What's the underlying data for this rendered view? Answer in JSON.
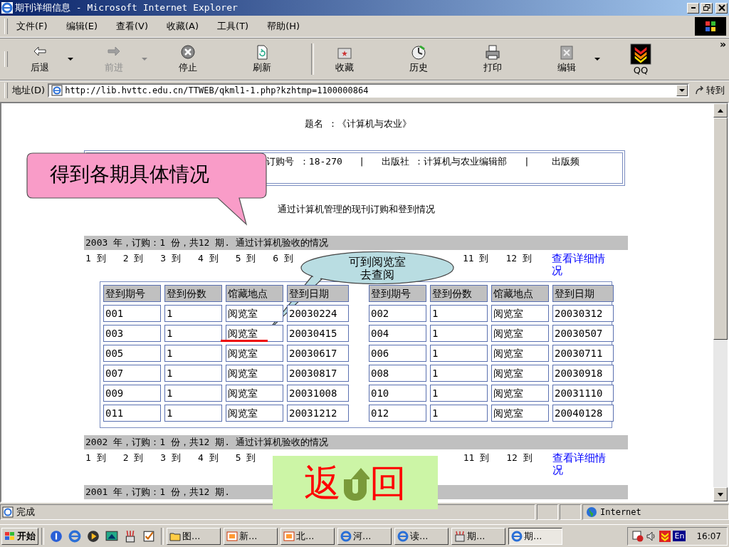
{
  "window": {
    "title": "期刊详细信息 - Microsoft Internet Explorer"
  },
  "menu": [
    "文件(F)",
    "编辑(E)",
    "查看(V)",
    "收藏(A)",
    "工具(T)",
    "帮助(H)"
  ],
  "toolbar": [
    {
      "label": "后退",
      "kind": "back",
      "disabled": false,
      "dropdown": true
    },
    {
      "label": "前进",
      "kind": "forward",
      "disabled": true,
      "dropdown": true
    },
    {
      "label": "停止",
      "kind": "stop",
      "disabled": false,
      "dropdown": false
    },
    {
      "label": "刷新",
      "kind": "refresh",
      "disabled": false,
      "dropdown": false
    },
    {
      "label": "收藏",
      "kind": "favorites",
      "disabled": false,
      "dropdown": false
    },
    {
      "label": "历史",
      "kind": "history",
      "disabled": false,
      "dropdown": false
    },
    {
      "label": "打印",
      "kind": "print",
      "disabled": false,
      "dropdown": false
    },
    {
      "label": "编辑",
      "kind": "edit",
      "disabled": false,
      "dropdown": true
    },
    {
      "label": "QQ",
      "kind": "qq",
      "disabled": false,
      "dropdown": false
    }
  ],
  "toolbar_more": "»",
  "address": {
    "label": "地址(D)",
    "value": "http://lib.hvttc.edu.cn/TTWEB/qkml1-1.php?kzhtmp=1100000864",
    "go": "转到"
  },
  "page": {
    "title": "题名 ：《计算机与农业》",
    "info": "订购号 ：18-270   |   出版社 ：计算机与农业编辑部   |    出版频",
    "subtitle": "通过计算机管理的现刊订购和登到情况",
    "years": [
      {
        "summary": "2003 年，订购：1 份，共12 期. 通过计算机验收的情况",
        "links_left": [
          "1 到",
          "2 到",
          "3 到",
          "4 到",
          "5 到",
          "6 到"
        ],
        "links_right": [
          "11 到",
          "12 到"
        ],
        "detail_link": "查看详细情况",
        "table": {
          "headers": [
            "登到期号",
            "登到份数",
            "馆藏地点",
            "登到日期",
            "登到期号",
            "登到份数",
            "馆藏地点",
            "登到日期"
          ],
          "rows": [
            [
              "001",
              "1",
              "阅览室",
              "20030224",
              "002",
              "1",
              "阅览室",
              "20030312"
            ],
            [
              "003",
              "1",
              "阅览室",
              "20030415",
              "004",
              "1",
              "阅览室",
              "20030507"
            ],
            [
              "005",
              "1",
              "阅览室",
              "20030617",
              "006",
              "1",
              "阅览室",
              "20030711"
            ],
            [
              "007",
              "1",
              "阅览室",
              "20030817",
              "008",
              "1",
              "阅览室",
              "20030918"
            ],
            [
              "009",
              "1",
              "阅览室",
              "20031008",
              "010",
              "1",
              "阅览室",
              "20031110"
            ],
            [
              "011",
              "1",
              "阅览室",
              "20031212",
              "012",
              "1",
              "阅览室",
              "20040128"
            ]
          ]
        }
      },
      {
        "summary": "2002 年，订购：1 份，共12 期. 通过计算机验收的情况",
        "links_left": [
          "1 到",
          "2 到",
          "3 到",
          "4 到",
          "5 到"
        ],
        "links_right": [
          "11 到",
          "12 到"
        ],
        "detail_link": "查看详细情况"
      },
      {
        "summary": "2001 年，订购：1 份，共12 期."
      }
    ]
  },
  "callouts": [
    {
      "kind": "rect",
      "text": "得到各期具体情况"
    },
    {
      "kind": "ellipse",
      "text": "可到阅览室去查阅"
    }
  ],
  "return_button": {
    "left": "返",
    "right": "回"
  },
  "status": {
    "text": "完成",
    "zone": "Internet"
  },
  "taskbar": {
    "start": "开始",
    "tasks": [
      {
        "label": "图...",
        "kind": "folder",
        "selected": false
      },
      {
        "label": "新...",
        "kind": "slides",
        "selected": false
      },
      {
        "label": "北...",
        "kind": "slides",
        "selected": false
      },
      {
        "label": "河...",
        "kind": "ie",
        "selected": false
      },
      {
        "label": "读...",
        "kind": "ie",
        "selected": false
      },
      {
        "label": "期...",
        "kind": "tool",
        "selected": false
      },
      {
        "label": "期...",
        "kind": "ie",
        "selected": true
      }
    ],
    "lang": "En",
    "time": "16:07"
  }
}
